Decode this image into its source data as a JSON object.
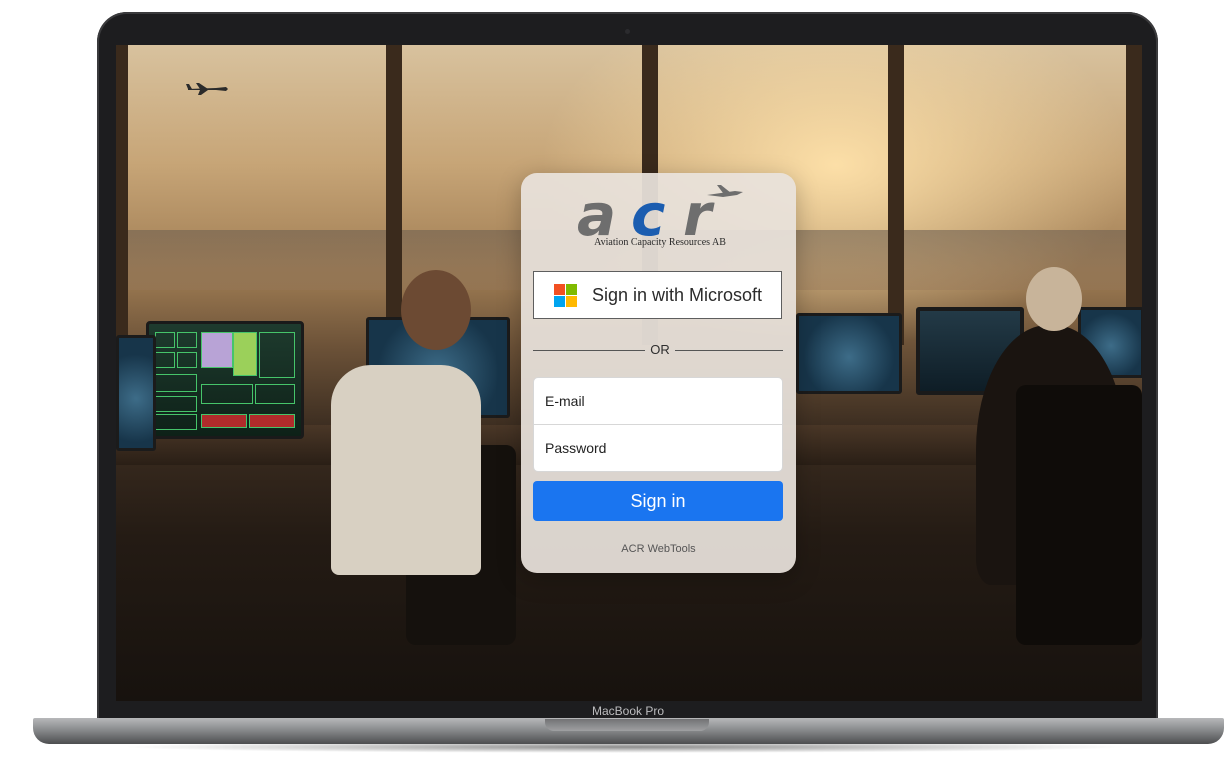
{
  "device": {
    "label": "MacBook Pro"
  },
  "login": {
    "logo": {
      "wordmark": "acr",
      "caption": "Aviation Capacity Resources AB"
    },
    "microsoft_button": "Sign in with Microsoft",
    "divider": "OR",
    "email": {
      "placeholder": "E-mail"
    },
    "password": {
      "placeholder": "Password"
    },
    "submit": "Sign in",
    "footer": "ACR WebTools"
  },
  "colors": {
    "primary_button": "#1a75f0",
    "logo_gray": "#6e6e6e",
    "logo_blue": "#1b5db0",
    "ms_red": "#f25022",
    "ms_green": "#7fba00",
    "ms_blue": "#00a4ef",
    "ms_yellow": "#ffb900"
  },
  "icons": {
    "microsoft": "microsoft-logo-icon",
    "airplane": "airplane-icon"
  }
}
